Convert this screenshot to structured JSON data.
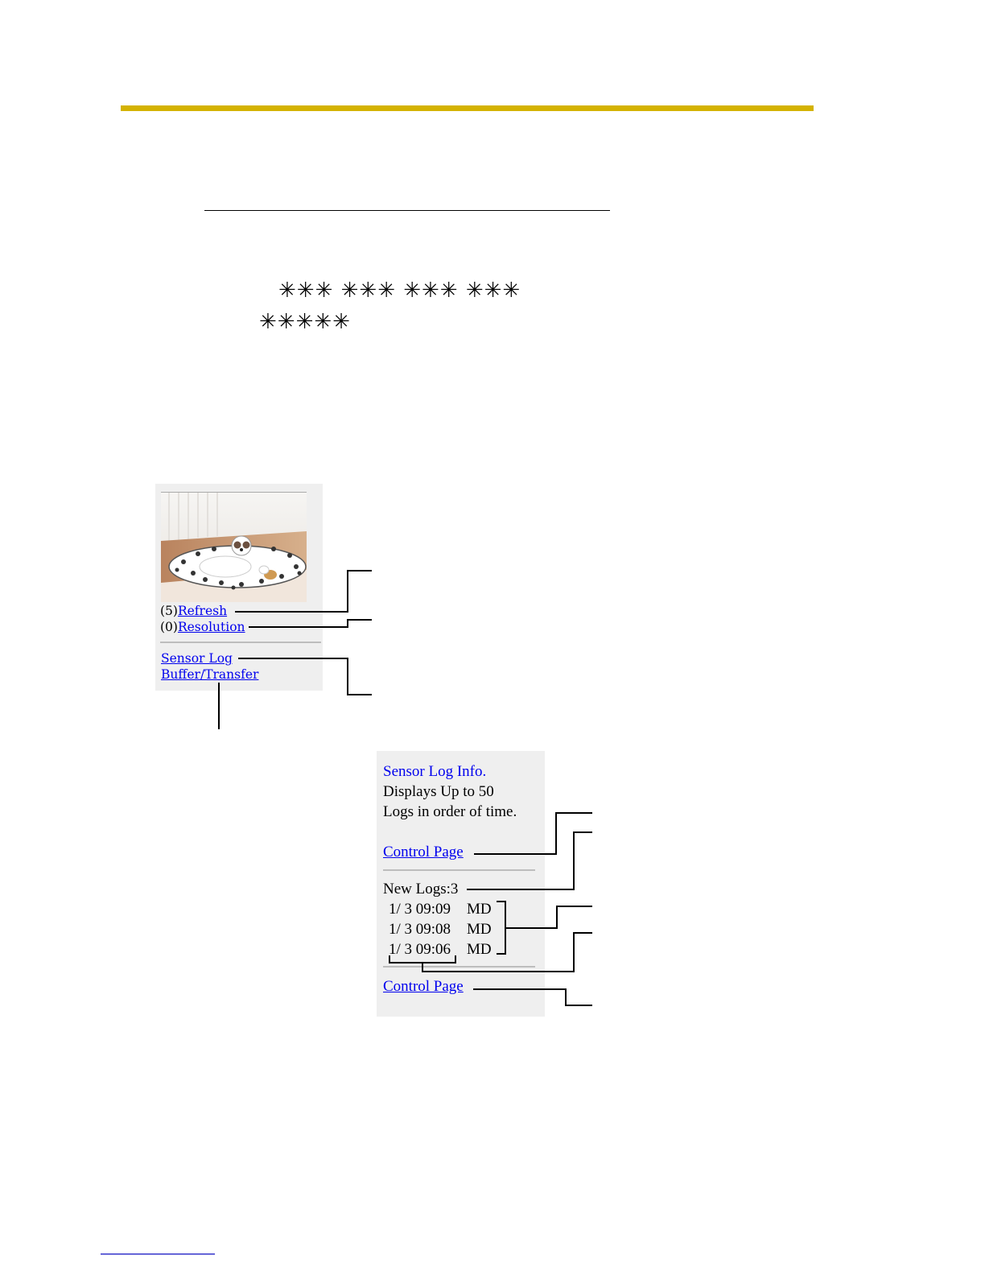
{
  "colors": {
    "accent_bar": "#d4b200",
    "link": "#0000ee",
    "panel_bg": "#efefef"
  },
  "masked": {
    "line1": "✳✳✳ ✳✳✳ ✳✳✳ ✳✳✳",
    "line2": "✳✳✳✳✳"
  },
  "camera_panel": {
    "image_icon": "dog-on-cushion-photo",
    "refresh_prefix": "(5)",
    "refresh_label": "Refresh",
    "resolution_prefix": "(0)",
    "resolution_label": "Resolution",
    "sensor_log_label": "Sensor Log",
    "buffer_transfer_label": "Buffer/Transfer"
  },
  "sensor_log_panel": {
    "title": "Sensor Log Info.",
    "desc_line1": "Displays Up to 50",
    "desc_line2": "Logs in order of time.",
    "control_page_top": "Control Page",
    "new_logs": "New Logs:3",
    "logs": [
      {
        "time": "1/ 3 09:09",
        "type": "MD"
      },
      {
        "time": "1/ 3 09:08",
        "type": "MD"
      },
      {
        "time": "1/ 3 09:06",
        "type": "MD"
      }
    ],
    "control_page_bottom": "Control Page"
  }
}
